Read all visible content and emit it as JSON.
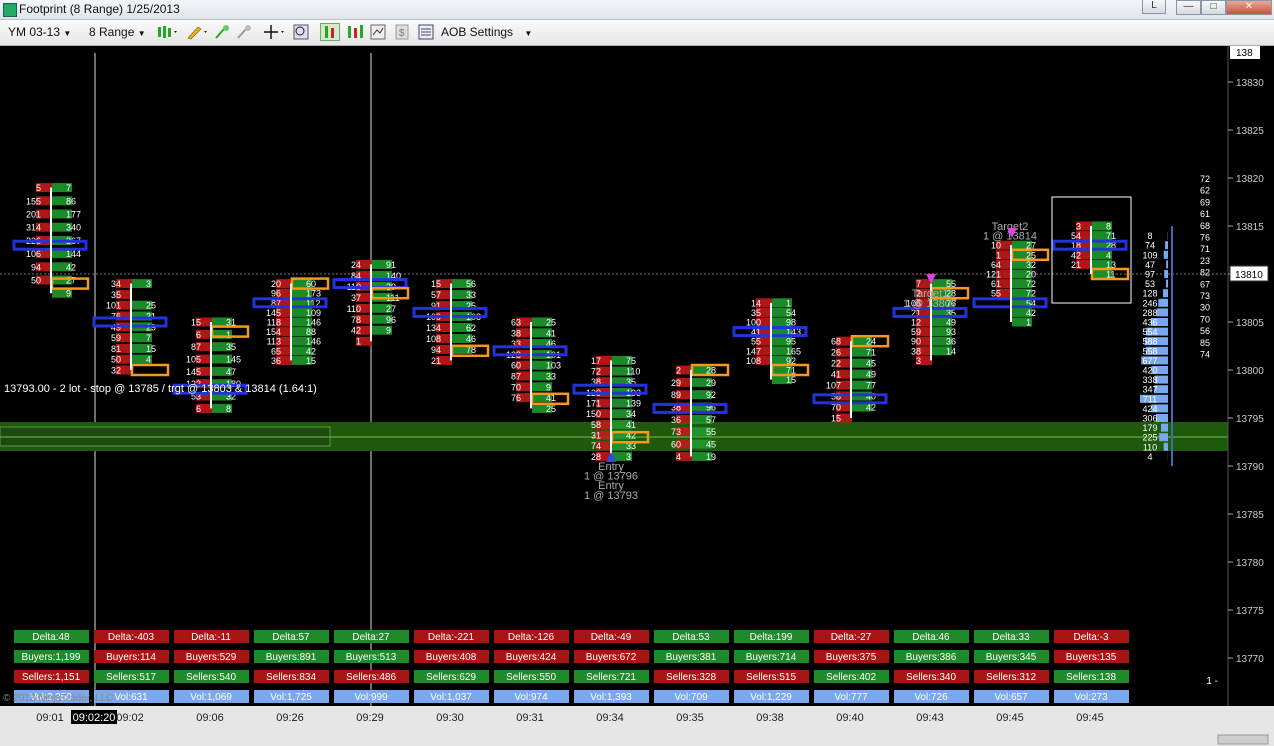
{
  "window": {
    "title": "Footprint (8 Range)  1/25/2013",
    "lang_button": "L",
    "min": "—",
    "max": "□",
    "close": "✕"
  },
  "toolbar": {
    "instrument": "YM 03-13",
    "period": "8 Range",
    "aob_settings": "AOB Settings"
  },
  "colors": {
    "buy": "#1e9a2e",
    "sell": "#c21a1a",
    "poc": "#2233dd",
    "imbalance": "#f39a1a",
    "volume_profile": "#7aa8ee",
    "trade_zone": "#1f5a0c",
    "grid": "#1a1a1a"
  },
  "price_axis": {
    "labels": [
      "13830",
      "13825",
      "13820",
      "13815",
      "13810",
      "13805",
      "13800",
      "13795",
      "13790",
      "13785",
      "13780",
      "13775",
      "13770"
    ],
    "current_price": "13810",
    "top_partial": "138"
  },
  "time_axis": {
    "labels": [
      "09:01",
      "09:02",
      "09:06",
      "09:26",
      "09:29",
      "09:30",
      "09:31",
      "09:34",
      "09:35",
      "09:38",
      "09:40",
      "09:43",
      "09:45",
      "09:45"
    ],
    "cursor_time": "09:02:20"
  },
  "trade": {
    "label": "13793.00 - 2 lot - stop @ 13785 / trgt @ 13803 & 13814 (1.64:1)",
    "annotations": [
      {
        "text": "Entry",
        "bar": 7,
        "price": 13790
      },
      {
        "text": "1 @ 13796",
        "bar": 7,
        "price": 13789
      },
      {
        "text": "Entry",
        "bar": 7,
        "price": 13788
      },
      {
        "text": "1 @ 13793",
        "bar": 7,
        "price": 13787
      },
      {
        "text": "Target1",
        "bar": 11,
        "price": 13808
      },
      {
        "text": "1 @ 13807",
        "bar": 11,
        "price": 13807
      },
      {
        "text": "Target2",
        "bar": 12,
        "price": 13815
      },
      {
        "text": "1 @ 13814",
        "bar": 12,
        "price": 13814
      }
    ]
  },
  "copyright": "© 2013 NinjaTrader, LLC",
  "vp_right_labels": [
    "72",
    "62",
    "69",
    "61",
    "68",
    "76",
    "71",
    "23",
    "82",
    "67",
    "73",
    "30",
    "70",
    "56",
    "85",
    "74"
  ],
  "vp_right_marks": [
    "1 -"
  ],
  "chart_data": {
    "type": "footprint",
    "price_range": [
      13766,
      13834
    ],
    "tick": 1,
    "bars": [
      {
        "time": "09:01",
        "high": 13819,
        "low": 13808,
        "poc": 13813,
        "bid": [
          "5",
          "155",
          "201",
          "314",
          "226",
          "106",
          "94",
          "50"
        ],
        "ask": [
          "7",
          "86",
          "177",
          "340",
          "367",
          "144",
          "42",
          "27",
          "9"
        ],
        "imbalance": [
          13809
        ]
      },
      {
        "time": "09:02",
        "high": 13809,
        "low": 13800,
        "poc": 13805,
        "bid": [
          "34",
          "35",
          "101",
          "76",
          "49",
          "59",
          "81",
          "50",
          "32"
        ],
        "ask": [
          "3",
          "",
          "25",
          "31",
          "29",
          "7",
          "15",
          "4"
        ],
        "imbalance": [
          13800
        ]
      },
      {
        "time": "09:06",
        "high": 13805,
        "low": 13796,
        "poc": 13798,
        "bid": [
          "15",
          "6",
          "87",
          "105",
          "145",
          "122",
          "53",
          "6"
        ],
        "ask": [
          "31",
          "1",
          "35",
          "145",
          "47",
          "180",
          "32",
          "8"
        ],
        "imbalance": [
          13804
        ]
      },
      {
        "time": "09:26",
        "high": 13809,
        "low": 13801,
        "poc": 13807,
        "bid": [
          "20",
          "96",
          "87",
          "145",
          "118",
          "154",
          "113",
          "65",
          "36"
        ],
        "ask": [
          "60",
          "173",
          "112",
          "109",
          "146",
          "88",
          "146",
          "42",
          "15"
        ],
        "imbalance": [
          13809
        ]
      },
      {
        "time": "09:29",
        "high": 13811,
        "low": 13803,
        "poc": 13809,
        "bid": [
          "24",
          "84",
          "110",
          "37",
          "110",
          "78",
          "42",
          "1"
        ],
        "ask": [
          "91",
          "140",
          "39",
          "111",
          "27",
          "96",
          "9"
        ],
        "imbalance": [
          13808
        ]
      },
      {
        "time": "09:30",
        "high": 13809,
        "low": 13801,
        "poc": 13806,
        "bid": [
          "15",
          "57",
          "91",
          "109",
          "134",
          "108",
          "94",
          "21"
        ],
        "ask": [
          "56",
          "33",
          "25",
          "108",
          "62",
          "46",
          "78"
        ],
        "imbalance": [
          13802
        ]
      },
      {
        "time": "09:31",
        "high": 13805,
        "low": 13796,
        "poc": 13802,
        "bid": [
          "63",
          "38",
          "33",
          "123",
          "60",
          "87",
          "70",
          "76"
        ],
        "ask": [
          "25",
          "41",
          "46",
          "101",
          "103",
          "33",
          "9",
          "41",
          "25"
        ],
        "imbalance": [
          13797
        ]
      },
      {
        "time": "09:34",
        "high": 13801,
        "low": 13791,
        "poc": 13798,
        "bid": [
          "17",
          "72",
          "38",
          "120",
          "171",
          "150",
          "58",
          "31",
          "74",
          "28"
        ],
        "ask": [
          "75",
          "110",
          "35",
          "193",
          "139",
          "34",
          "41",
          "42",
          "33",
          "3"
        ],
        "imbalance": [
          13793
        ]
      },
      {
        "time": "09:35",
        "high": 13800,
        "low": 13791,
        "poc": 13796,
        "bid": [
          "2",
          "29",
          "89",
          "38",
          "36",
          "73",
          "60",
          "4"
        ],
        "ask": [
          "28",
          "29",
          "92",
          "96",
          "57",
          "55",
          "45",
          "19"
        ],
        "imbalance": [
          13800
        ]
      },
      {
        "time": "09:38",
        "high": 13807,
        "low": 13799,
        "poc": 13804,
        "bid": [
          "14",
          "35",
          "100",
          "41",
          "55",
          "147",
          "108"
        ],
        "ask": [
          "1",
          "54",
          "98",
          "143",
          "95",
          "165",
          "92",
          "71",
          "15"
        ],
        "imbalance": [
          13800
        ]
      },
      {
        "time": "09:40",
        "high": 13803,
        "low": 13795,
        "poc": 13797,
        "bid": [
          "68",
          "26",
          "22",
          "41",
          "107",
          "58",
          "70",
          "15"
        ],
        "ask": [
          "24",
          "71",
          "45",
          "49",
          "77",
          "40",
          "42"
        ],
        "imbalance": [
          13803
        ]
      },
      {
        "time": "09:43",
        "high": 13809,
        "low": 13801,
        "poc": 13806,
        "bid": [
          "7",
          "2",
          "108",
          "21",
          "12",
          "59",
          "90",
          "38",
          "3"
        ],
        "ask": [
          "55",
          "28",
          "76",
          "35",
          "49",
          "93",
          "36",
          "14"
        ],
        "imbalance": [
          13808
        ]
      },
      {
        "time": "09:45",
        "high": 13813,
        "low": 13805,
        "poc": 13807,
        "bid": [
          "10",
          "1",
          "64",
          "121",
          "61",
          "55"
        ],
        "ask": [
          "27",
          "25",
          "32",
          "20",
          "72",
          "72",
          "54",
          "42",
          "1"
        ],
        "imbalance": [
          13812
        ]
      },
      {
        "time": "09:45",
        "high": 13815,
        "low": 13810,
        "poc": 13813,
        "bid": [
          "3",
          "54",
          "18",
          "42",
          "21"
        ],
        "ask": [
          "8",
          "71",
          "28",
          "4",
          "13",
          "11"
        ],
        "imbalance": [
          13810
        ]
      }
    ],
    "stats": {
      "delta": [
        "Delta:48",
        "Delta:-403",
        "Delta:-11",
        "Delta:57",
        "Delta:27",
        "Delta:-221",
        "Delta:-126",
        "Delta:-49",
        "Delta:53",
        "Delta:199",
        "Delta:-27",
        "Delta:46",
        "Delta:33",
        "Delta:-3"
      ],
      "delta_values": [
        48,
        -403,
        -11,
        57,
        27,
        -221,
        -126,
        -49,
        53,
        199,
        -27,
        46,
        33,
        -3
      ],
      "buyers": [
        "Buyers:1,199",
        "Buyers:114",
        "Buyers:529",
        "Buyers:891",
        "Buyers:513",
        "Buyers:408",
        "Buyers:424",
        "Buyers:672",
        "Buyers:381",
        "Buyers:714",
        "Buyers:375",
        "Buyers:386",
        "Buyers:345",
        "Buyers:135"
      ],
      "buyers_values": [
        1199,
        114,
        529,
        891,
        513,
        408,
        424,
        672,
        381,
        714,
        375,
        386,
        345,
        135
      ],
      "sellers": [
        "Sellers:1,151",
        "Sellers:517",
        "Sellers:540",
        "Sellers:834",
        "Sellers:486",
        "Sellers:629",
        "Sellers:550",
        "Sellers:721",
        "Sellers:328",
        "Sellers:515",
        "Sellers:402",
        "Sellers:340",
        "Sellers:312",
        "Sellers:138"
      ],
      "sellers_values": [
        1151,
        517,
        540,
        834,
        486,
        629,
        550,
        721,
        328,
        515,
        402,
        340,
        312,
        138
      ],
      "volume": [
        "Vol:2,350",
        "Vol:631",
        "Vol:1,069",
        "Vol:1,725",
        "Vol:999",
        "Vol:1,037",
        "Vol:974",
        "Vol:1,393",
        "Vol:709",
        "Vol:1,229",
        "Vol:777",
        "Vol:726",
        "Vol:657",
        "Vol:273"
      ]
    },
    "volume_profile": {
      "labels": [
        "8",
        "74",
        "109",
        "47",
        "97",
        "53",
        "128",
        "246",
        "288",
        "436",
        "554",
        "588",
        "558",
        "677",
        "420",
        "338",
        "347",
        "711",
        "424",
        "306",
        "179",
        "225",
        "110",
        "4"
      ],
      "prices": [
        13814,
        13813,
        13812,
        13811,
        13810,
        13809,
        13808,
        13807,
        13806,
        13805,
        13804,
        13803,
        13802,
        13801,
        13800,
        13799,
        13798,
        13797,
        13796,
        13795,
        13794,
        13793,
        13792,
        13791
      ],
      "values": [
        8,
        74,
        109,
        47,
        97,
        53,
        128,
        246,
        288,
        436,
        554,
        588,
        558,
        677,
        420,
        338,
        347,
        711,
        424,
        306,
        179,
        225,
        110,
        4
      ]
    }
  }
}
